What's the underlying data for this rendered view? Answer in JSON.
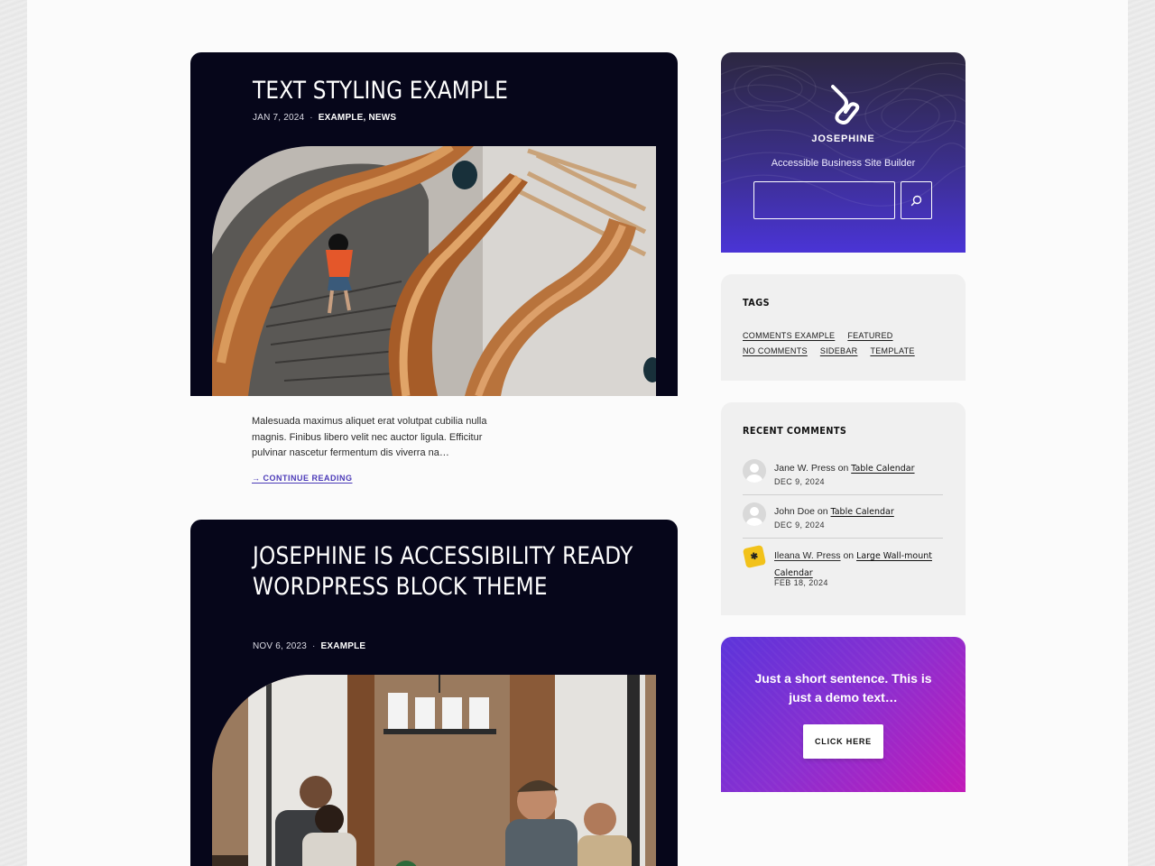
{
  "posts": [
    {
      "title": "TEXT STYLING EXAMPLE",
      "date": "JAN 7, 2024",
      "separator": "·",
      "categories": "EXAMPLE, NEWS",
      "image": "spiral-staircase-photo"
    },
    {
      "title": "JOSEPHINE IS ACCESSIBILITY READY WORDPRESS BLOCK THEME",
      "date": "NOV 6, 2023",
      "separator": "·",
      "categories": "EXAMPLE",
      "image": "office-meeting-photo"
    }
  ],
  "excerpt": "Malesuada maximus aliquet erat volutpat cubilia nulla magnis. Finibus libero velit nec auctor ligula. Efficitur pulvinar nascetur fermentum dis viverra na…",
  "continue_reading": "→ CONTINUE READING",
  "brand": {
    "name": "JOSEPHINE",
    "tagline": "Accessible Business Site Builder",
    "logo_icon": "josephine-logo",
    "search_icon": "search-icon",
    "search_value": ""
  },
  "tags_widget": {
    "title": "TAGS",
    "row1": [
      "COMMENTS EXAMPLE",
      "FEATURED"
    ],
    "row2": [
      "NO COMMENTS",
      "SIDEBAR",
      "TEMPLATE"
    ]
  },
  "comments_widget": {
    "title": "RECENT COMMENTS",
    "on_word": "on",
    "items": [
      {
        "author": "Jane W. Press",
        "post": "Table Calendar",
        "date": "DEC 9, 2024",
        "avatar": "generic-avatar"
      },
      {
        "author": "John Doe",
        "post": "Table Calendar",
        "date": "DEC 9, 2024",
        "avatar": "generic-avatar"
      },
      {
        "author": "Ileana W. Press",
        "post": "Large Wall-mount Calendar",
        "date": "FEB 18, 2024",
        "avatar": "logo-avatar"
      }
    ]
  },
  "cta": {
    "text": "Just a short sentence. This is just a demo text…",
    "button": "CLICK HERE"
  },
  "colors": {
    "post_card_bg": "#06061a",
    "accent_link": "#4b3ab8",
    "brand_gradient_end": "#4a34d6",
    "cta_gradient_start": "#5c34da",
    "cta_gradient_end": "#c21ab8"
  }
}
